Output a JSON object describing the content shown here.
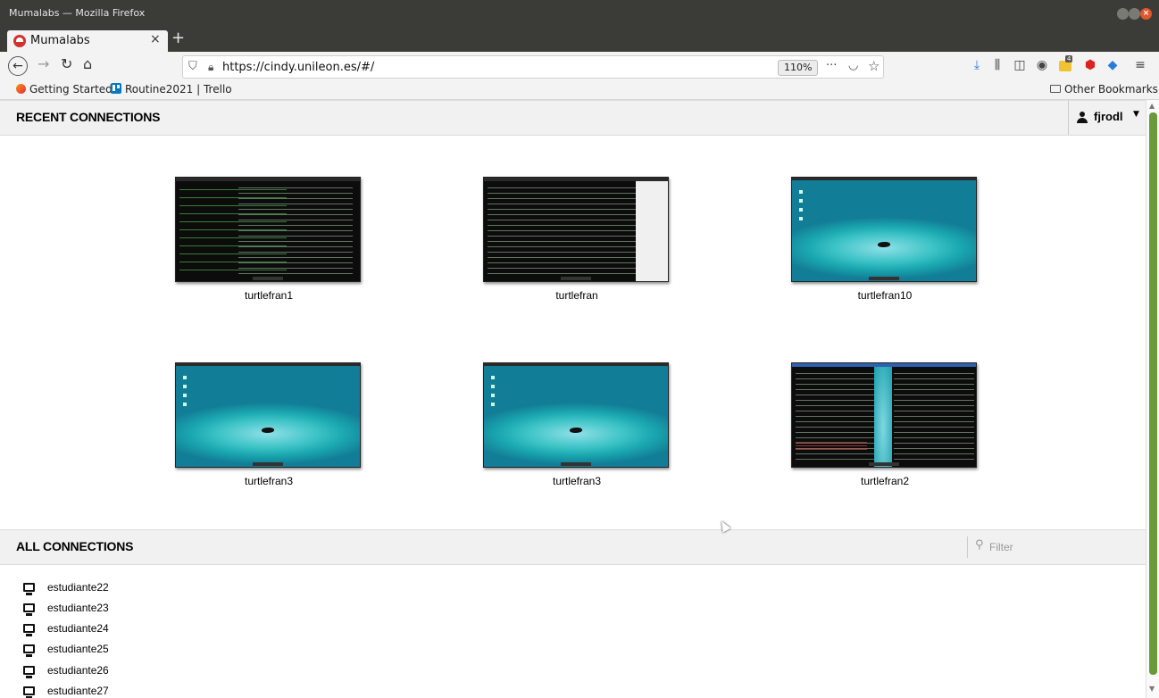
{
  "window": {
    "title": "Mumalabs — Mozilla Firefox"
  },
  "tab": {
    "label": "Mumalabs",
    "new_tab": "+"
  },
  "nav": {
    "url": "https://cindy.unileon.es/#/",
    "zoom": "110%"
  },
  "bookmarks": {
    "items": [
      {
        "label": "Getting Started"
      },
      {
        "label": "Routine2021 | Trello"
      }
    ],
    "other": "Other Bookmarks"
  },
  "toolbar": {
    "extension_badge": "4"
  },
  "recent": {
    "title": "RECENT CONNECTIONS",
    "user": "fjrodl",
    "items": [
      {
        "name": "turtlefran1",
        "kind": "terminal"
      },
      {
        "name": "turtlefran",
        "kind": "terminal-window"
      },
      {
        "name": "turtlefran10",
        "kind": "desktop"
      },
      {
        "name": "turtlefran3",
        "kind": "desktop"
      },
      {
        "name": "turtlefran3",
        "kind": "desktop"
      },
      {
        "name": "turtlefran2",
        "kind": "split"
      }
    ]
  },
  "all": {
    "title": "ALL CONNECTIONS",
    "filter_placeholder": "Filter",
    "items": [
      {
        "name": "estudiante22"
      },
      {
        "name": "estudiante23"
      },
      {
        "name": "estudiante24"
      },
      {
        "name": "estudiante25"
      },
      {
        "name": "estudiante26"
      },
      {
        "name": "estudiante27"
      }
    ]
  },
  "colors": {
    "titlebar": "#3b3b38",
    "accent": "#2a7ad8",
    "scrollbar": "#6a9a3a",
    "header_bg": "#f1f1f1"
  }
}
